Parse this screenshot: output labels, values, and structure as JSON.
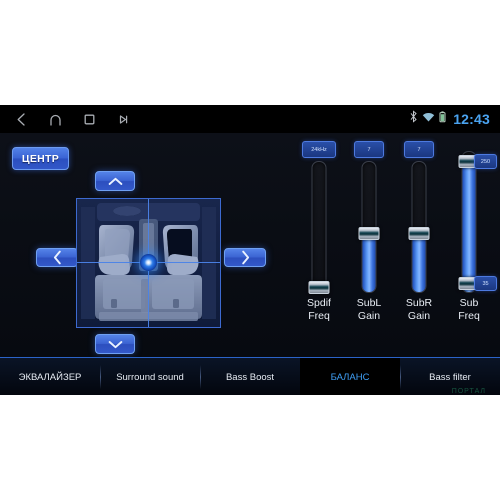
{
  "statusbar": {
    "nav": [
      {
        "name": "back-icon",
        "label": "Back"
      },
      {
        "name": "home-icon",
        "label": "Home"
      },
      {
        "name": "recents-icon",
        "label": "Recent apps"
      },
      {
        "name": "play-icon",
        "label": "Play"
      }
    ],
    "indicators": [
      {
        "name": "bluetooth-icon",
        "label": "Bluetooth"
      },
      {
        "name": "wifi-icon",
        "label": "Wi-Fi"
      },
      {
        "name": "battery-icon",
        "label": "Battery"
      }
    ],
    "clock": "12:43",
    "clock_color": "#4aa3f0"
  },
  "balance": {
    "center_button": "ЦЕНТР",
    "dpad": {
      "up": "up-arrow",
      "down": "down-arrow",
      "left": "left-arrow",
      "right": "right-arrow"
    },
    "car_view_label": "car-cabin-top-view"
  },
  "sliders": [
    {
      "id": "spdif-freq",
      "caption_line1": "Spdif",
      "caption_line2": "Freq",
      "badge": "24kHz",
      "value_pct": 0,
      "dual": false
    },
    {
      "id": "subl-gain",
      "caption_line1": "SubL",
      "caption_line2": "Gain",
      "badge": "7",
      "value_pct": 46,
      "dual": false
    },
    {
      "id": "subr-gain",
      "caption_line1": "SubR",
      "caption_line2": "Gain",
      "badge": "7",
      "value_pct": 46,
      "dual": false
    },
    {
      "id": "sub-freq",
      "caption_line1": "Sub",
      "caption_line2": "Freq",
      "badge_high": "250",
      "badge_low": "35",
      "high_pct": 97,
      "low_pct": 5,
      "dual": true
    }
  ],
  "tabs": [
    {
      "label": "ЭКВАЛАЙЗЕР",
      "active": false
    },
    {
      "label": "Surround sound",
      "active": false
    },
    {
      "label": "Bass Boost",
      "active": false
    },
    {
      "label": "БАЛАНС",
      "active": true
    },
    {
      "label": "Bass filter",
      "active": false
    }
  ],
  "accent_color": "#3f9ff5",
  "watermark": "ПОРТАЛ"
}
